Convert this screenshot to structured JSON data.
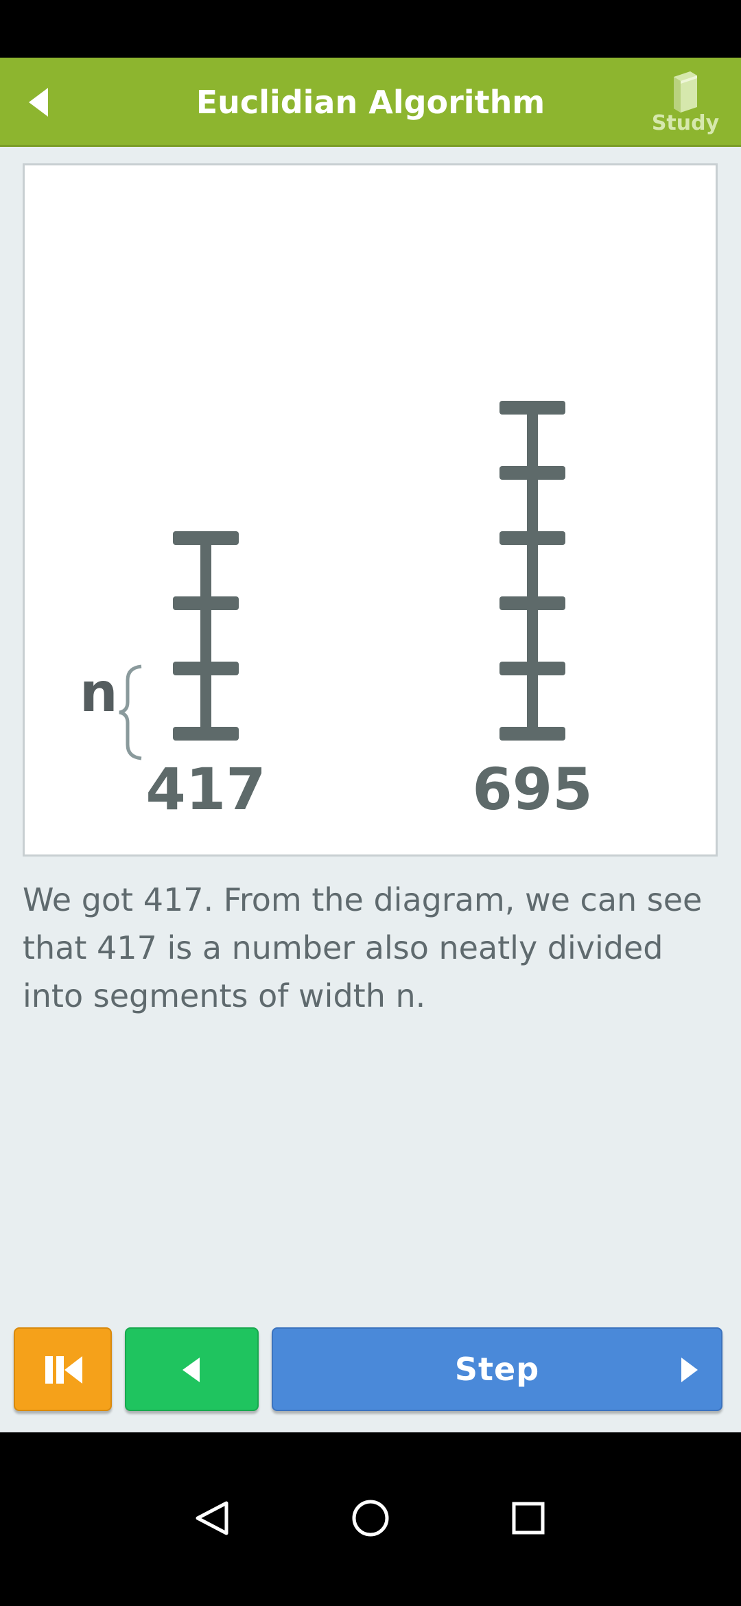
{
  "app_bar": {
    "title": "Euclidian Algorithm",
    "study_label": "Study"
  },
  "diagram": {
    "segment_label": "n",
    "bars": [
      {
        "value_label": "417",
        "segments": 3
      },
      {
        "value_label": "695",
        "segments": 5
      }
    ]
  },
  "explanation": "We got 417. From the diagram, we can see that 417 is a number also neatly divided into segments of width n.",
  "controls": {
    "step_label": "Step"
  },
  "colors": {
    "app_bar": "#8db52f",
    "bar_stroke": "#5e6a6a",
    "rewind": "#f5a11a",
    "prev": "#1fc45f",
    "step": "#4a89d9"
  }
}
